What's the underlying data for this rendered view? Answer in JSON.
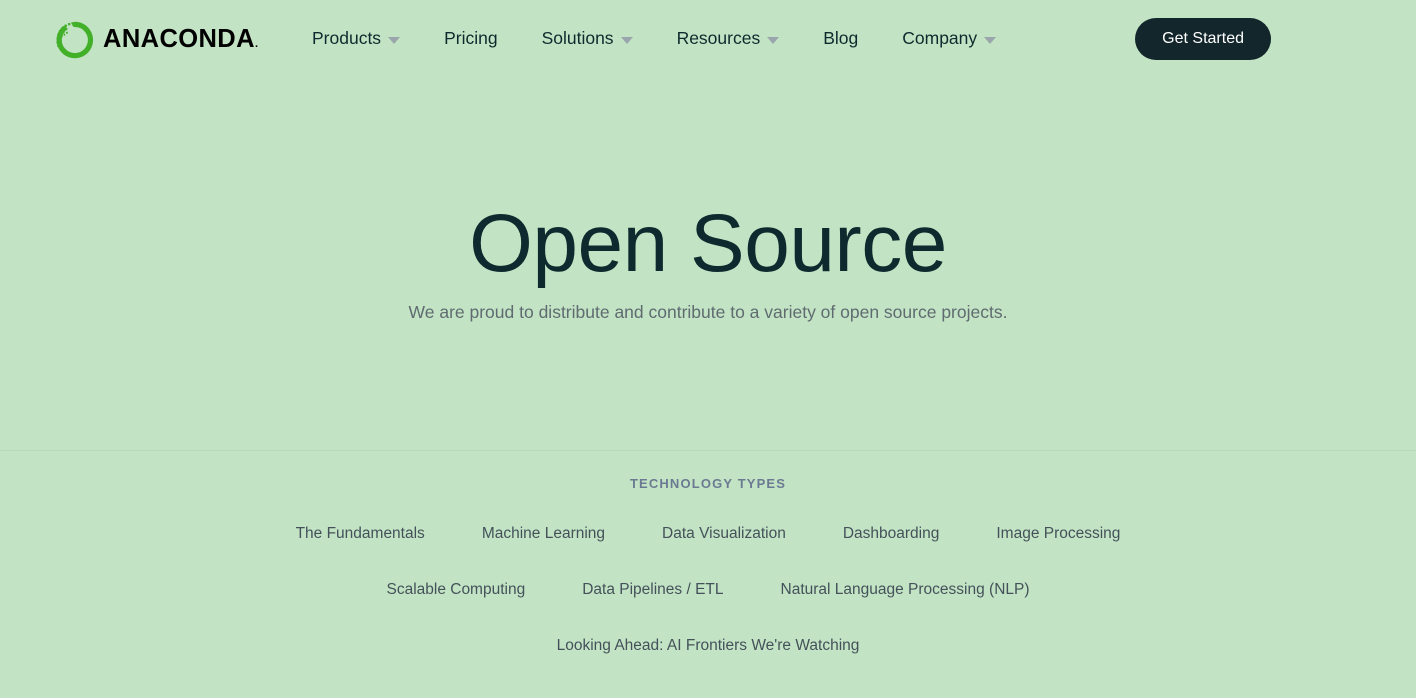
{
  "header": {
    "brand": {
      "name": "ANACONDA",
      "tm": ".",
      "logo_icon": "anaconda-ring-logo"
    },
    "nav": [
      {
        "label": "Products",
        "has_dropdown": true
      },
      {
        "label": "Pricing",
        "has_dropdown": false
      },
      {
        "label": "Solutions",
        "has_dropdown": true
      },
      {
        "label": "Resources",
        "has_dropdown": true
      },
      {
        "label": "Blog",
        "has_dropdown": false
      },
      {
        "label": "Company",
        "has_dropdown": true
      }
    ],
    "cta_label": "Get Started"
  },
  "hero": {
    "title": "Open Source",
    "subtitle": "We are proud to distribute and contribute to a variety of open source projects."
  },
  "tech": {
    "label": "TECHNOLOGY TYPES",
    "rows": [
      [
        "The Fundamentals",
        "Machine Learning",
        "Data Visualization",
        "Dashboarding",
        "Image Processing"
      ],
      [
        "Scalable Computing",
        "Data Pipelines / ETL",
        "Natural Language Processing (NLP)"
      ],
      [
        "Looking Ahead: AI Frontiers We're Watching"
      ]
    ]
  },
  "colors": {
    "background": "#c3e4c4",
    "brand_green": "#43b02a",
    "text_dark": "#0f2a2e",
    "text_muted": "#5f6b70",
    "label_blue_grey": "#6b7a92",
    "cta_background": "#13262b",
    "divider": "#b5dbb7"
  }
}
